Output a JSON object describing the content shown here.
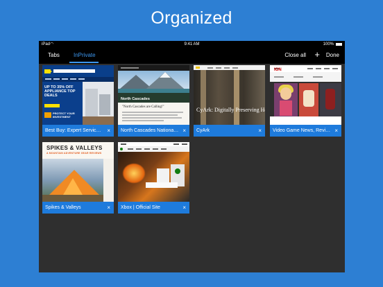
{
  "headline": "Organized",
  "status_bar": {
    "device": "iPad",
    "time": "9:41 AM",
    "battery": "100%"
  },
  "toolbar": {
    "tabs_label": "Tabs",
    "inprivate_label": "InPrivate",
    "close_all_label": "Close all",
    "add_label": "+",
    "done_label": "Done"
  },
  "tabs": [
    {
      "title": "Best Buy: Expert Service. U...",
      "close": "×"
    },
    {
      "title": "North Cascades National P...",
      "close": "×"
    },
    {
      "title": "CyArk",
      "close": "×"
    },
    {
      "title": "Video Game News, Review...",
      "close": "×"
    },
    {
      "title": "Spikes & Valleys",
      "close": "×"
    },
    {
      "title": "Xbox | Official Site",
      "close": "×"
    }
  ],
  "thumbnails": {
    "bestbuy_promo": "UP TO 35% OFF APPLIANCE TOP DEALS",
    "bestbuy_geek": "PROTECT YOUR INVESTMENT",
    "cascades_label": "North Cascades",
    "cascades_heading": "\"North Cascades are Calling!\"",
    "cyark_title": "CyArk: Digitally Preserving Her",
    "ign_logo": "IGN",
    "spikes_title": "SPIKES & VALLEYS",
    "spikes_sub": "A MOUNTAIN ADVENTURE GEAR REVIEWS"
  },
  "colors": {
    "background": "#2d7fd3",
    "caption": "#1e7bdc",
    "accent": "#3d98f0"
  }
}
